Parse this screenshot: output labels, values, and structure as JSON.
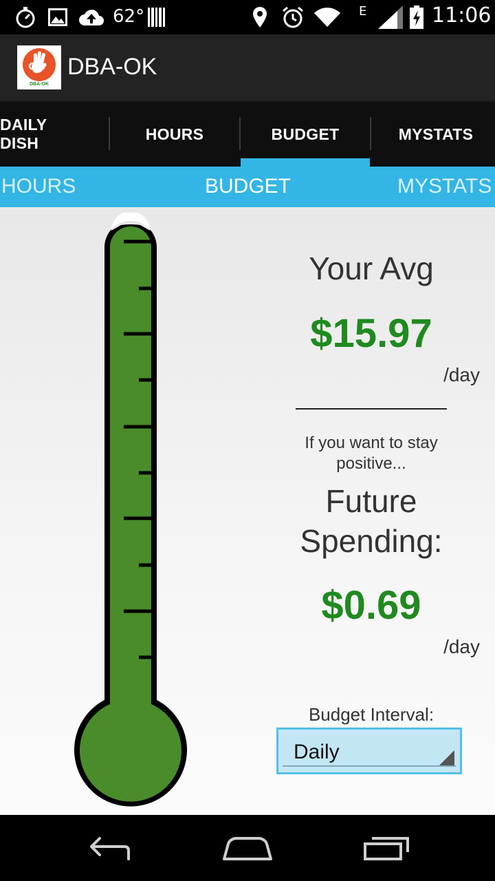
{
  "status_bar": {
    "temperature": "62°",
    "network_type": "E",
    "time": "11:06",
    "icons": [
      "stopwatch-icon",
      "image-icon",
      "cloud-upload-icon",
      "barcode-icon",
      "location-icon",
      "alarm-icon",
      "wifi-icon",
      "signal-icon",
      "battery-charging-icon"
    ]
  },
  "action_bar": {
    "app_icon_label": "DBA-OK",
    "title": "DBA-OK"
  },
  "tabs": [
    {
      "label": "DAILY DISH",
      "selected": false
    },
    {
      "label": "HOURS",
      "selected": false
    },
    {
      "label": "BUDGET",
      "selected": true
    },
    {
      "label": "MYSTATS",
      "selected": false
    }
  ],
  "pager": {
    "prev": "HOURS",
    "current": "BUDGET",
    "next": "MYSTATS"
  },
  "budget": {
    "avg_title": "Your Avg",
    "avg_value": "$15.97",
    "avg_unit": "/day",
    "stay_positive": "If you want to stay positive...",
    "future_title": "Future Spending:",
    "future_value": "$0.69",
    "future_unit": "/day",
    "interval_label": "Budget Interval:",
    "interval_value": "Daily"
  },
  "thermometer": {
    "fill_fraction": 1.0,
    "fill_color": "#4a8c2a"
  },
  "colors": {
    "accent": "#33b5e5",
    "money_green": "#1f8a1f",
    "app_icon_orange": "#e8532a"
  },
  "nav_bar": {
    "icons": [
      "back-icon",
      "home-icon",
      "recent-apps-icon"
    ]
  }
}
